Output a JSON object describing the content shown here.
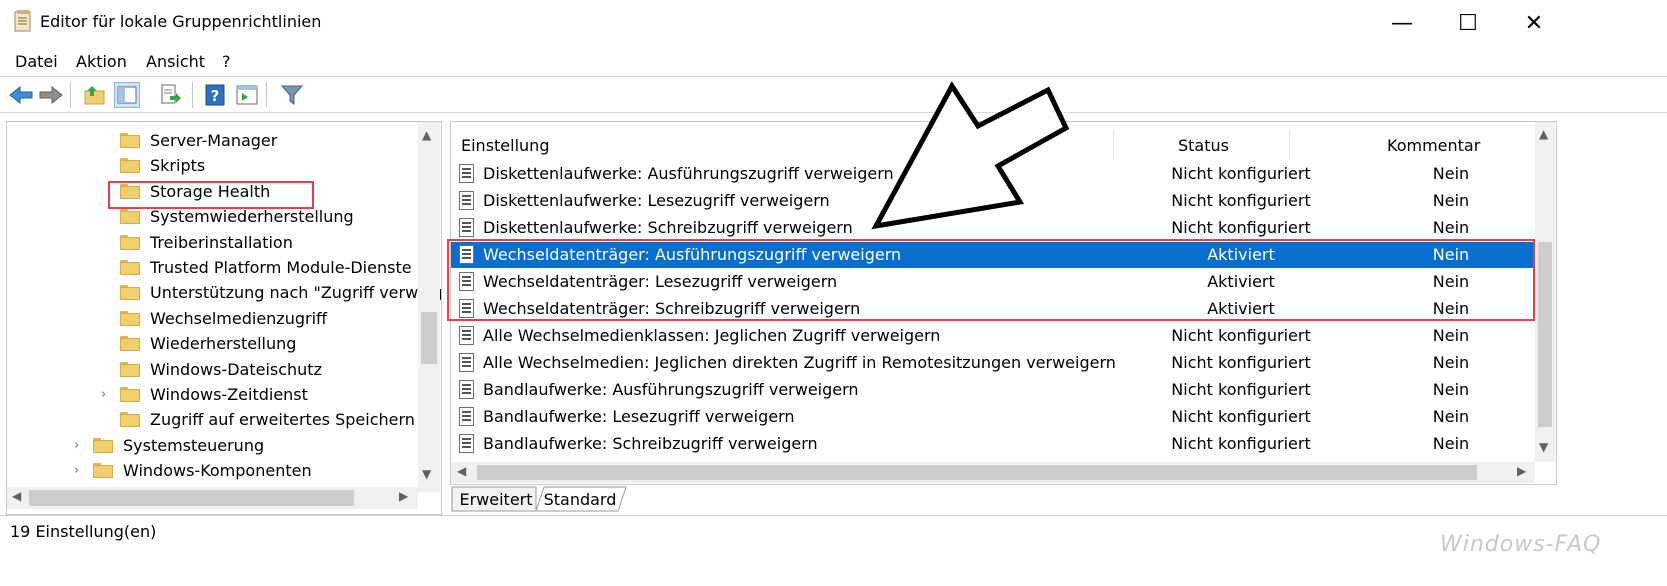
{
  "window": {
    "title": "Editor für lokale Gruppenrichtlinien",
    "minimize_glyph": "—",
    "maximize_glyph": "☐",
    "close_glyph": "✕"
  },
  "menu": [
    "Datei",
    "Aktion",
    "Ansicht",
    "?"
  ],
  "toolbar": {
    "icons": [
      "back-arrow-icon",
      "forward-arrow-icon",
      "up-folder-icon",
      "show-hide-tree-icon",
      "export-list-icon",
      "help-icon",
      "extended-view-icon",
      "filter-icon"
    ]
  },
  "tree": {
    "items": [
      {
        "label": "Server-Manager",
        "level": 2
      },
      {
        "label": "Skripts",
        "level": 2
      },
      {
        "label": "Storage Health",
        "level": 2
      },
      {
        "label": "Systemwiederherstellung",
        "level": 2
      },
      {
        "label": "Treiberinstallation",
        "level": 2
      },
      {
        "label": "Trusted Platform Module-Dienste",
        "level": 2
      },
      {
        "label": "Unterstützung nach \"Zugriff verweig",
        "level": 2
      },
      {
        "label": "Wechselmedienzugriff",
        "level": 2,
        "selected": true
      },
      {
        "label": "Wiederherstellung",
        "level": 2
      },
      {
        "label": "Windows-Dateischutz",
        "level": 2
      },
      {
        "label": "Windows-Zeitdienst",
        "level": 2,
        "expandable": true
      },
      {
        "label": "Zugriff auf erweitertes Speichern",
        "level": 2
      },
      {
        "label": "Systemsteuerung",
        "level": 1,
        "expandable": true
      },
      {
        "label": "Windows-Komponenten",
        "level": 1,
        "expandable": true
      }
    ]
  },
  "list": {
    "columns": {
      "setting": "Einstellung",
      "status": "Status",
      "comment": "Kommentar"
    },
    "rows": [
      {
        "setting": "Diskettenlaufwerke: Ausführungszugriff verweigern",
        "status": "Nicht konfiguriert",
        "comment": "Nein"
      },
      {
        "setting": "Diskettenlaufwerke: Lesezugriff verweigern",
        "status": "Nicht konfiguriert",
        "comment": "Nein"
      },
      {
        "setting": "Diskettenlaufwerke: Schreibzugriff verweigern",
        "status": "Nicht konfiguriert",
        "comment": "Nein"
      },
      {
        "setting": "Wechseldatenträger: Ausführungszugriff verweigern",
        "status": "Aktiviert",
        "comment": "Nein",
        "selected": true
      },
      {
        "setting": "Wechseldatenträger: Lesezugriff verweigern",
        "status": "Aktiviert",
        "comment": "Nein"
      },
      {
        "setting": "Wechseldatenträger: Schreibzugriff verweigern",
        "status": "Aktiviert",
        "comment": "Nein"
      },
      {
        "setting": "Alle Wechselmedienklassen: Jeglichen Zugriff verweigern",
        "status": "Nicht konfiguriert",
        "comment": "Nein"
      },
      {
        "setting": "Alle Wechselmedien: Jeglichen direkten Zugriff in Remotesitzungen verweigern",
        "status": "Nicht konfiguriert",
        "comment": "Nein"
      },
      {
        "setting": "Bandlaufwerke: Ausführungszugriff verweigern",
        "status": "Nicht konfiguriert",
        "comment": "Nein"
      },
      {
        "setting": "Bandlaufwerke: Lesezugriff verweigern",
        "status": "Nicht konfiguriert",
        "comment": "Nein"
      },
      {
        "setting": "Bandlaufwerke: Schreibzugriff verweigern",
        "status": "Nicht konfiguriert",
        "comment": "Nein"
      }
    ]
  },
  "tabs": [
    "Erweitert",
    "Standard"
  ],
  "statusbar": "19 Einstellung(en)",
  "watermark": "Windows-FAQ",
  "colors": {
    "selection": "#0a6ecf",
    "highlight_box": "#e3424a",
    "folder": "#f0cf6e"
  }
}
